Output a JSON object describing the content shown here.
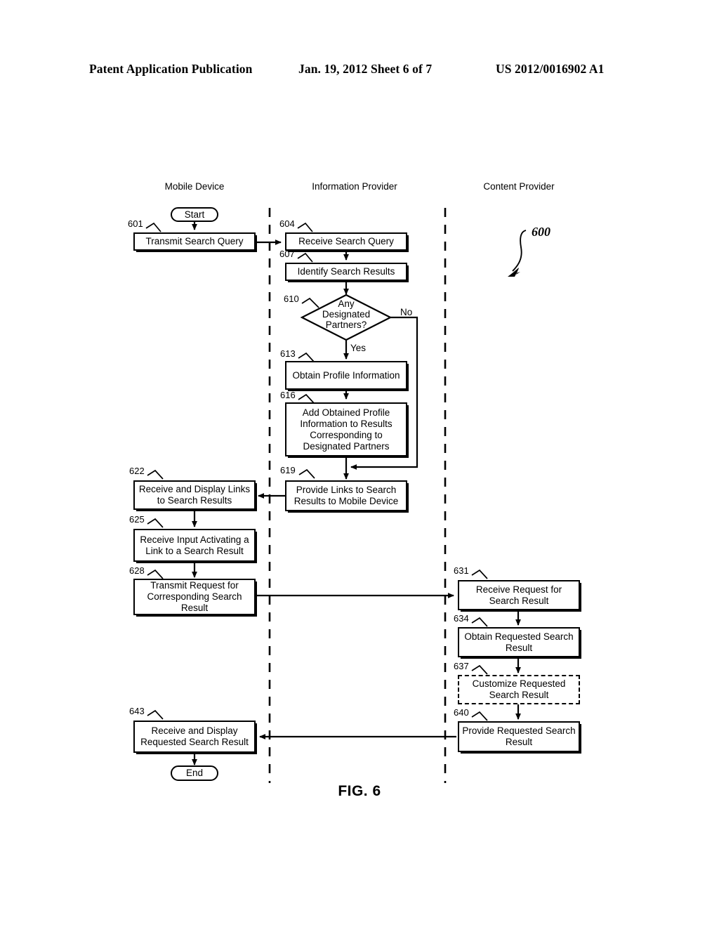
{
  "header": {
    "left": "Patent Application Publication",
    "middle": "Jan. 19, 2012  Sheet 6 of 7",
    "right": "US 2012/0016902 A1"
  },
  "figure": {
    "caption": "FIG. 6",
    "callout": "600",
    "lanes": [
      {
        "id": "mobile-device",
        "title": "Mobile Device"
      },
      {
        "id": "information-provider",
        "title": "Information Provider"
      },
      {
        "id": "content-provider",
        "title": "Content Provider"
      }
    ],
    "terminators": [
      {
        "id": "start",
        "label": "Start"
      },
      {
        "id": "end",
        "label": "End"
      }
    ],
    "decision": {
      "ref": "610",
      "line1": "Any",
      "line2": "Designated",
      "line3": "Partners?",
      "yes_label": "Yes",
      "no_label": "No"
    },
    "steps": [
      {
        "ref": "601",
        "lane": "mobile-device",
        "text": "Transmit Search Query"
      },
      {
        "ref": "604",
        "lane": "information-provider",
        "text": "Receive Search Query"
      },
      {
        "ref": "607",
        "lane": "information-provider",
        "text": "Identify Search Results"
      },
      {
        "ref": "613",
        "lane": "information-provider",
        "text": "Obtain Profile Information"
      },
      {
        "ref": "616",
        "lane": "information-provider",
        "text": "Add Obtained Profile Information to Results Corresponding to Designated Partners"
      },
      {
        "ref": "619",
        "lane": "information-provider",
        "text": "Provide Links to Search Results to Mobile Device"
      },
      {
        "ref": "622",
        "lane": "mobile-device",
        "text": "Receive and Display Links to Search Results"
      },
      {
        "ref": "625",
        "lane": "mobile-device",
        "text": "Receive Input Activating a Link to a Search Result"
      },
      {
        "ref": "628",
        "lane": "mobile-device",
        "text": "Transmit Request for Corresponding Search Result"
      },
      {
        "ref": "631",
        "lane": "content-provider",
        "text": "Receive Request for Search Result"
      },
      {
        "ref": "634",
        "lane": "content-provider",
        "text": "Obtain Requested Search Result"
      },
      {
        "ref": "637",
        "lane": "content-provider",
        "text": "Customize Requested Search Result",
        "optional": true
      },
      {
        "ref": "640",
        "lane": "content-provider",
        "text": "Provide Requested Search Result"
      },
      {
        "ref": "643",
        "lane": "mobile-device",
        "text": "Receive and Display Requested Search Result"
      }
    ]
  },
  "chart_data": {
    "type": "diagram",
    "title": "FIG. 6",
    "diagram_kind": "swimlane-flowchart",
    "lanes": [
      "Mobile Device",
      "Information Provider",
      "Content Provider"
    ],
    "nodes": [
      {
        "ref": "start",
        "kind": "terminator",
        "label": "Start",
        "lane": "Mobile Device"
      },
      {
        "ref": "601",
        "kind": "process",
        "label": "Transmit Search Query",
        "lane": "Mobile Device"
      },
      {
        "ref": "604",
        "kind": "process",
        "label": "Receive Search Query",
        "lane": "Information Provider"
      },
      {
        "ref": "607",
        "kind": "process",
        "label": "Identify Search Results",
        "lane": "Information Provider"
      },
      {
        "ref": "610",
        "kind": "decision",
        "label": "Any Designated Partners?",
        "lane": "Information Provider"
      },
      {
        "ref": "613",
        "kind": "process",
        "label": "Obtain Profile Information",
        "lane": "Information Provider"
      },
      {
        "ref": "616",
        "kind": "process",
        "label": "Add Obtained Profile Information to Results Corresponding to Designated Partners",
        "lane": "Information Provider"
      },
      {
        "ref": "619",
        "kind": "process",
        "label": "Provide Links to Search Results to Mobile Device",
        "lane": "Information Provider"
      },
      {
        "ref": "622",
        "kind": "process",
        "label": "Receive and Display Links to Search Results",
        "lane": "Mobile Device"
      },
      {
        "ref": "625",
        "kind": "process",
        "label": "Receive Input Activating a Link to a Search Result",
        "lane": "Mobile Device"
      },
      {
        "ref": "628",
        "kind": "process",
        "label": "Transmit Request for Corresponding Search Result",
        "lane": "Mobile Device"
      },
      {
        "ref": "631",
        "kind": "process",
        "label": "Receive Request for Search Result",
        "lane": "Content Provider"
      },
      {
        "ref": "634",
        "kind": "process",
        "label": "Obtain Requested Search Result",
        "lane": "Content Provider"
      },
      {
        "ref": "637",
        "kind": "process-optional",
        "label": "Customize Requested Search Result",
        "lane": "Content Provider"
      },
      {
        "ref": "640",
        "kind": "process",
        "label": "Provide Requested Search Result",
        "lane": "Content Provider"
      },
      {
        "ref": "643",
        "kind": "process",
        "label": "Receive and Display Requested Search Result",
        "lane": "Mobile Device"
      },
      {
        "ref": "end",
        "kind": "terminator",
        "label": "End",
        "lane": "Mobile Device"
      }
    ],
    "edges": [
      {
        "from": "start",
        "to": "601",
        "label": ""
      },
      {
        "from": "601",
        "to": "604",
        "label": ""
      },
      {
        "from": "604",
        "to": "607",
        "label": ""
      },
      {
        "from": "607",
        "to": "610",
        "label": ""
      },
      {
        "from": "610",
        "to": "613",
        "label": "Yes"
      },
      {
        "from": "610",
        "to": "619",
        "label": "No"
      },
      {
        "from": "613",
        "to": "616",
        "label": ""
      },
      {
        "from": "616",
        "to": "619",
        "label": ""
      },
      {
        "from": "619",
        "to": "622",
        "label": ""
      },
      {
        "from": "622",
        "to": "625",
        "label": ""
      },
      {
        "from": "625",
        "to": "628",
        "label": ""
      },
      {
        "from": "628",
        "to": "631",
        "label": ""
      },
      {
        "from": "631",
        "to": "634",
        "label": ""
      },
      {
        "from": "634",
        "to": "637",
        "label": ""
      },
      {
        "from": "637",
        "to": "640",
        "label": ""
      },
      {
        "from": "640",
        "to": "643",
        "label": ""
      },
      {
        "from": "643",
        "to": "end",
        "label": ""
      }
    ]
  }
}
